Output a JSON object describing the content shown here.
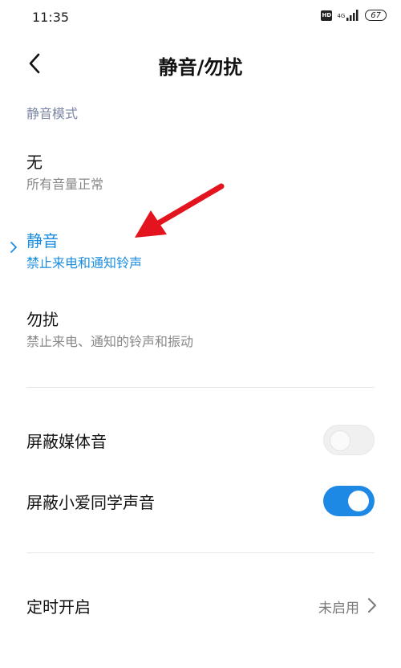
{
  "status_bar": {
    "time": "11:35",
    "hd": "HD",
    "network": "4G",
    "battery": "67"
  },
  "header": {
    "back_icon": "chevron-left-icon",
    "title": "静音/勿扰"
  },
  "section": {
    "label": "静音模式"
  },
  "modes": [
    {
      "title": "无",
      "description": "所有音量正常",
      "selected": false
    },
    {
      "title": "静音",
      "description": "禁止来电和通知铃声",
      "selected": true
    },
    {
      "title": "勿扰",
      "description": "禁止来电、通知的铃声和振动",
      "selected": false
    }
  ],
  "toggles": [
    {
      "label": "屏蔽媒体音",
      "state": "off"
    },
    {
      "label": "屏蔽小爱同学声音",
      "state": "on"
    }
  ],
  "schedule": {
    "label": "定时开启",
    "value": "未启用"
  },
  "colors": {
    "accent": "#1a8de0",
    "toggle_on": "#1e88e5",
    "section_header": "#7a86a3",
    "annotation": "#e3141e"
  }
}
